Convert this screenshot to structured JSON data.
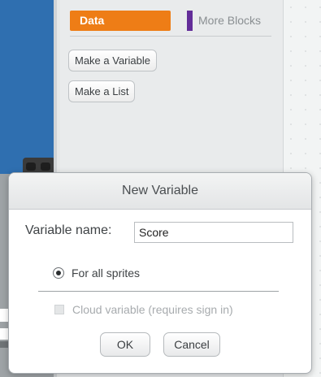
{
  "palette": {
    "categories": [
      {
        "label": "Data",
        "color": "#ee7d16",
        "active": true
      },
      {
        "label": "More Blocks",
        "color": "#632d99",
        "active": false
      }
    ],
    "buttons": {
      "make_variable": "Make a Variable",
      "make_list": "Make a List"
    }
  },
  "dialog": {
    "title": "New Variable",
    "variable_name_label": "Variable name:",
    "variable_name_value": "Score",
    "scope_option": "For all sprites",
    "cloud_option": "Cloud variable (requires sign in)",
    "ok_label": "OK",
    "cancel_label": "Cancel"
  }
}
